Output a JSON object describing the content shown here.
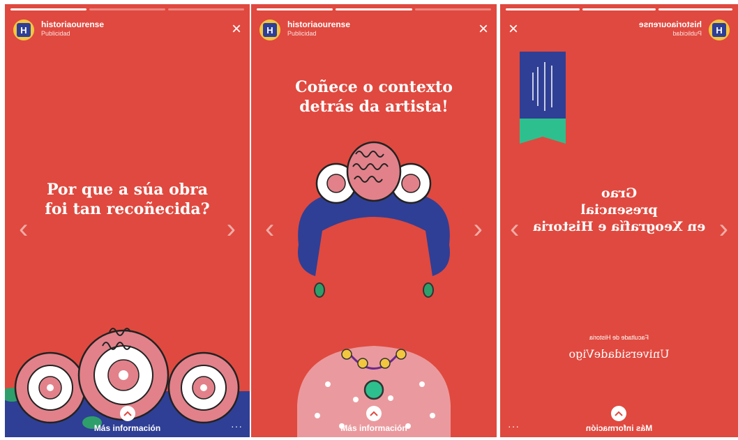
{
  "colors": {
    "story_background": "#e0493f",
    "brand_navy": "#2f3f95",
    "brand_teal": "#2ebf8e"
  },
  "stories": [
    {
      "account": "historiaourense",
      "subtitle": "Publicidad",
      "progress": [
        1,
        0,
        0
      ],
      "caption": [
        "Por que a súa obra",
        "foi tan recoñecida?"
      ],
      "cta_label": "Más información",
      "illustration": "roses"
    },
    {
      "account": "historiaourense",
      "subtitle": "Publicidad",
      "progress": [
        1,
        1,
        0
      ],
      "caption": [
        "Coñece o contexto",
        "detrás da artista!"
      ],
      "cta_label": "Más información",
      "illustration": "frida-portrait"
    },
    {
      "account": "historiaourense",
      "subtitle": "Publicidad",
      "progress": [
        1,
        1,
        1
      ],
      "caption": [
        "Grao",
        "presencial",
        "en Xeografía e Historia"
      ],
      "faculty": "Facultade de Historia",
      "university": "UniversidadeVigo",
      "cta_label": "Más información",
      "mirrored": true,
      "illustration": "university-banner"
    }
  ],
  "icons": {
    "close": "close-icon",
    "prev": "chevron-left-icon",
    "next": "chevron-right-icon",
    "cta": "chevron-up-icon",
    "more": "more-icon"
  }
}
